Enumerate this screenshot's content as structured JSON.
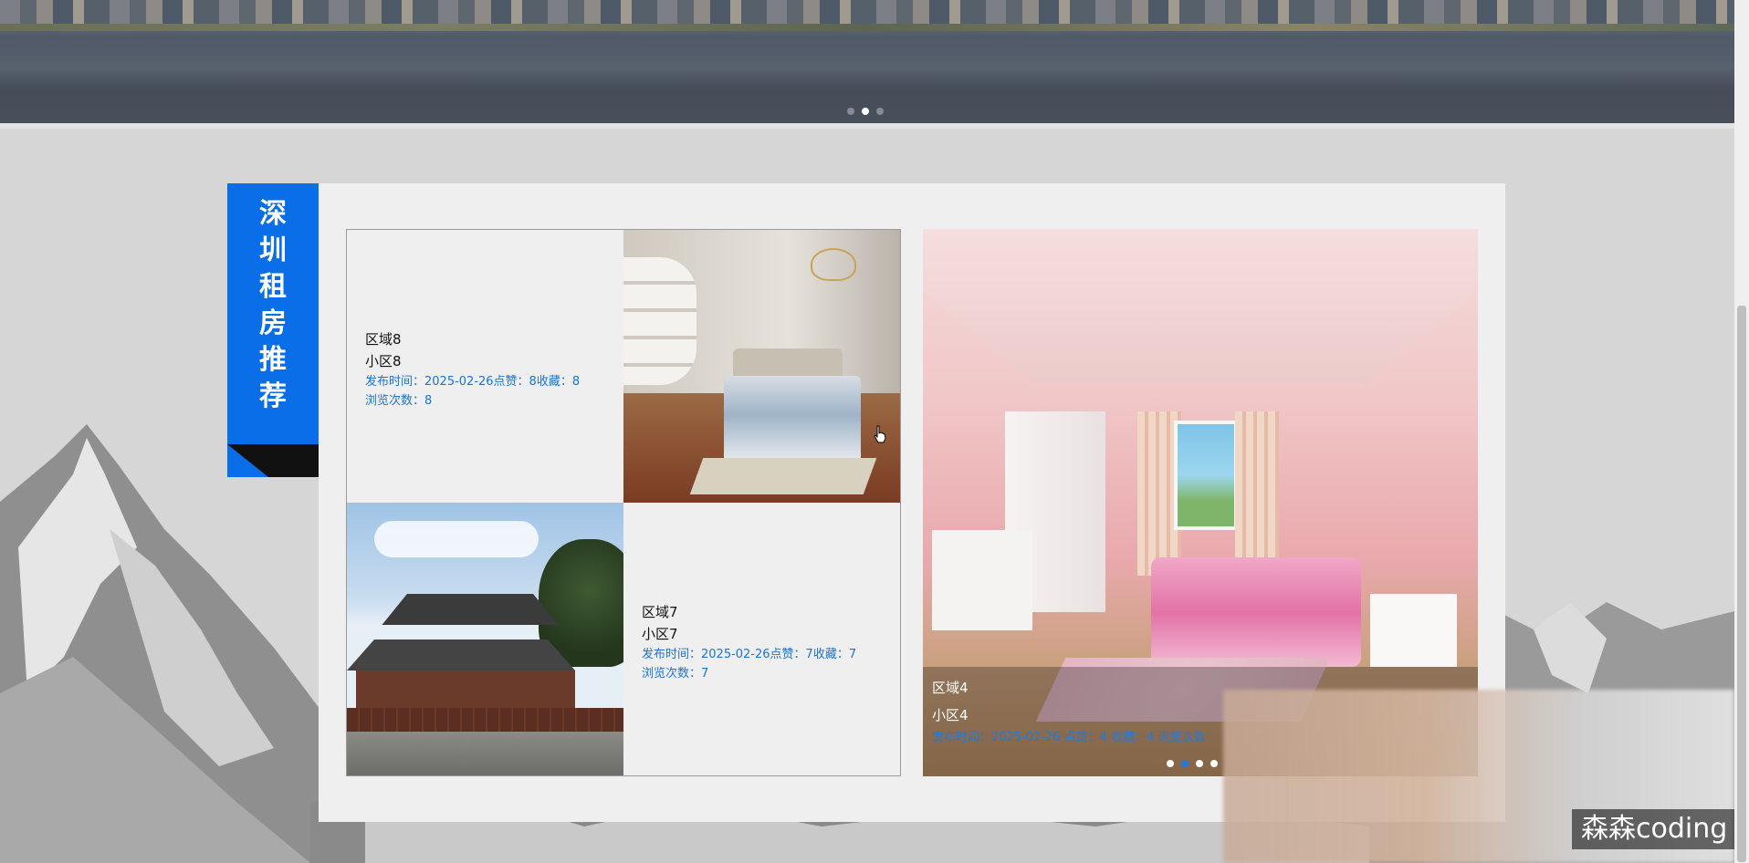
{
  "banner": {
    "dots": [
      {
        "active": false
      },
      {
        "active": true
      },
      {
        "active": false
      }
    ]
  },
  "section": {
    "title_chars": [
      "深",
      "圳",
      "租",
      "房",
      "推",
      "荐"
    ]
  },
  "listings": [
    {
      "area": "区域8",
      "community": "小区8",
      "meta": "发布时间：2025-02-26点赞：8收藏：8",
      "views": "浏览次数：8"
    },
    {
      "area": "区域7",
      "community": "小区7",
      "meta": "发布时间：2025-02-26点赞：7收藏：7",
      "views": "浏览次数：7"
    }
  ],
  "carousel": {
    "area": "区域4",
    "community": "小区4",
    "meta": "发布时间：2025-02-26   点赞：4  收藏：4   浏览次数",
    "dots_count": 4,
    "active_dot": 2
  },
  "watermark": "森森coding",
  "colors": {
    "ribbon": "#0a6ee8",
    "link_blue": "#1a73d9"
  }
}
